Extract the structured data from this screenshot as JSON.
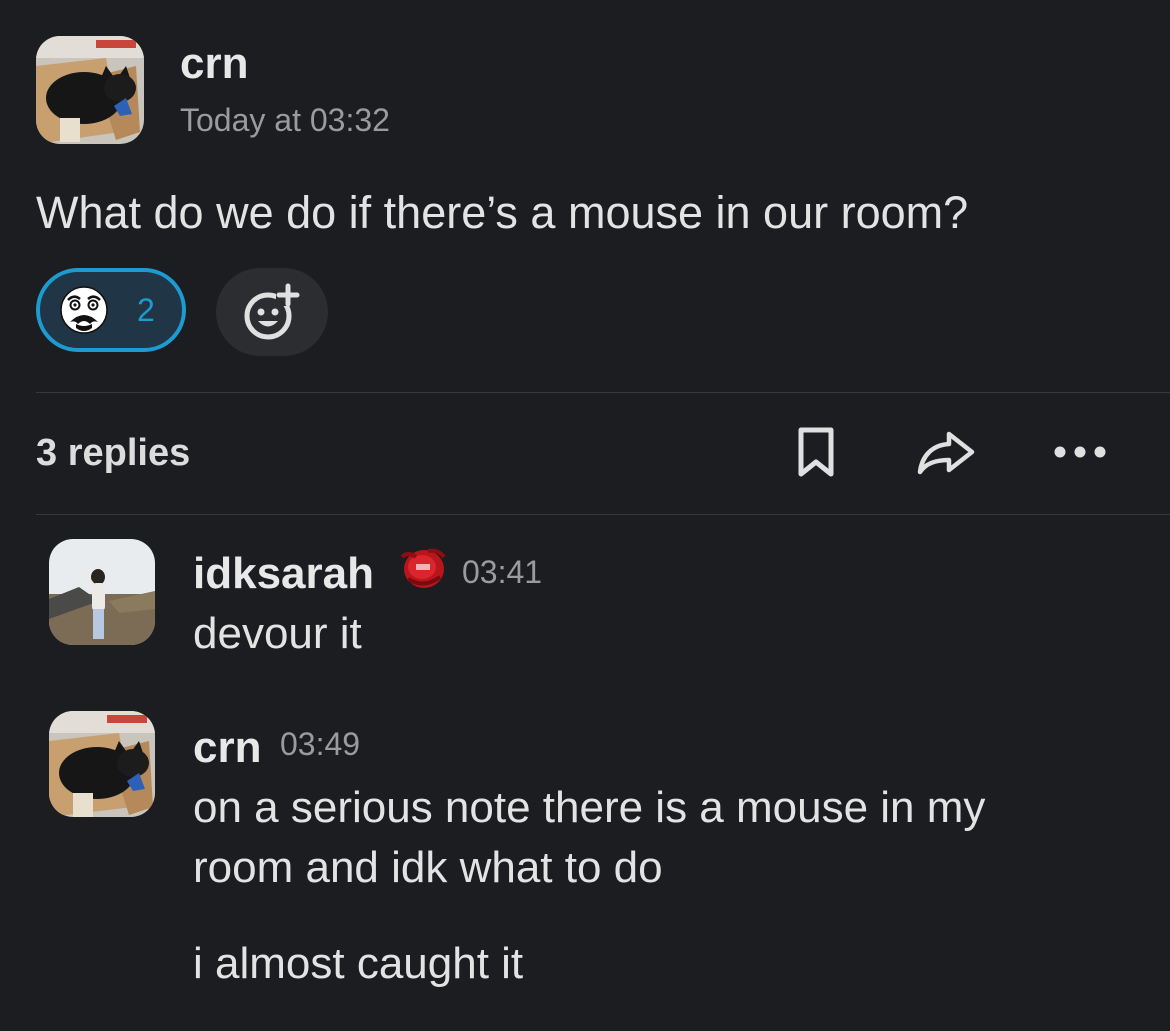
{
  "parent": {
    "author": "crn",
    "timestamp": "Today at 03:32",
    "text": "What do we do if there’s a mouse in our room?",
    "avatar": "cat-in-box-avatar",
    "reaction": {
      "emoji": "face-emoji",
      "count": "2"
    },
    "add_reaction_icon": "add-reaction-icon"
  },
  "thread": {
    "replies_label": "3 replies",
    "actions": [
      "bookmark-icon",
      "share-icon",
      "more-icon"
    ]
  },
  "replies": [
    {
      "author": "idksarah",
      "status_emoji": "red-emoji-icon",
      "time": "03:41",
      "text": "devour it",
      "avatar": "person-photo-avatar"
    },
    {
      "author": "crn",
      "time": "03:49",
      "lines": [
        "on a serious note there is a mouse in my",
        "room and idk what to do"
      ],
      "text2": "i almost caught it",
      "avatar": "cat-in-box-avatar"
    }
  ],
  "colors": {
    "background": "#1b1d21",
    "accent": "#1d9bd1",
    "muted": "#9a9b9d"
  }
}
